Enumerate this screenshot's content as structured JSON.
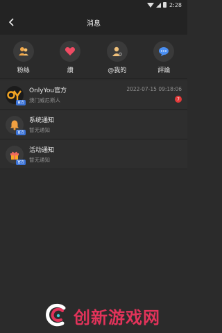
{
  "status_bar": {
    "time": "2:28"
  },
  "header": {
    "title": "消息"
  },
  "actions": [
    {
      "label": "粉絲",
      "icon": "fans-icon",
      "color": "#f2a84a"
    },
    {
      "label": "讚",
      "icon": "heart-icon",
      "color": "#ef4b63"
    },
    {
      "label": "@我的",
      "icon": "mention-user-icon",
      "color": "#f0c07a"
    },
    {
      "label": "評論",
      "icon": "comment-icon",
      "color": "#4a8ff2"
    }
  ],
  "messages": [
    {
      "title": "OnlyYou官方",
      "subtitle": "澳门威尼斯人",
      "time": "2022-07-15 09:18:06",
      "badge": "7",
      "tag": "官方"
    },
    {
      "title": "系统通知",
      "subtitle": "暂无通知",
      "tag": "官方"
    },
    {
      "title": "活动通知",
      "subtitle": "暂无通知",
      "tag": "官方"
    }
  ],
  "watermark": {
    "text": "创新游戏网"
  }
}
